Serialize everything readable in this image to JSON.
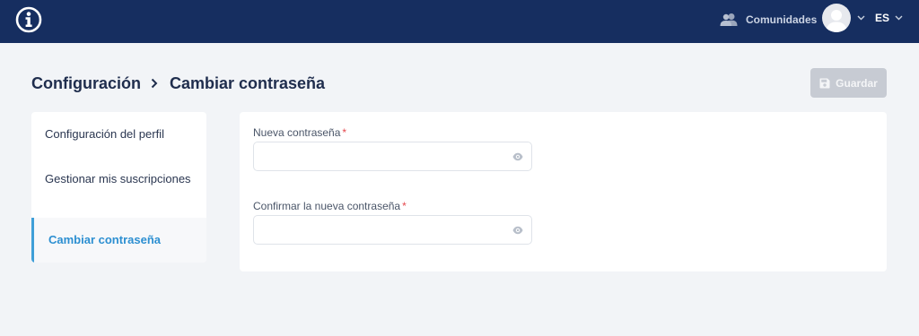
{
  "header": {
    "communities_label": "Comunidades",
    "language": "ES"
  },
  "breadcrumb": {
    "parent": "Configuración",
    "current": "Cambiar contraseña"
  },
  "toolbar": {
    "save_label": "Guardar"
  },
  "sidebar": {
    "items": [
      {
        "label": "Configuración del perfil",
        "active": false
      },
      {
        "label": "Gestionar mis suscripciones",
        "active": false
      },
      {
        "label": "Cambiar contraseña",
        "active": true
      }
    ]
  },
  "form": {
    "new_password": {
      "label": "Nueva contraseña",
      "required_mark": "*",
      "value": ""
    },
    "confirm_password": {
      "label": "Confirmar la nueva contraseña",
      "required_mark": "*",
      "value": ""
    }
  },
  "colors": {
    "header_bg": "#162e60",
    "accent": "#3f9fd8",
    "disabled_button": "#c7cbd3",
    "required": "#e5484d"
  },
  "icons": {
    "logo": "info-icon",
    "communities": "users-icon",
    "save": "floppy-disk-icon",
    "password_toggle": "eye-icon"
  }
}
